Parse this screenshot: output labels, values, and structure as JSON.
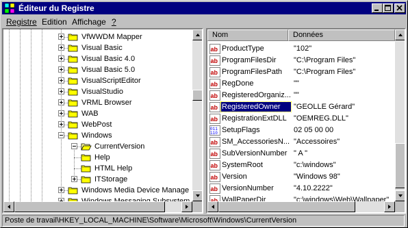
{
  "window": {
    "title": "Éditeur du Registre"
  },
  "menu": [
    {
      "label": "Registre"
    },
    {
      "label": "Edition"
    },
    {
      "label": "Affichage"
    },
    {
      "label": "?"
    }
  ],
  "tree": {
    "items": [
      {
        "label": "VfWWDM Mapper",
        "expander": "plus"
      },
      {
        "label": "Visual Basic",
        "expander": "plus"
      },
      {
        "label": "Visual Basic 4.0",
        "expander": "plus"
      },
      {
        "label": "Visual Basic 5.0",
        "expander": "plus"
      },
      {
        "label": "VisualScriptEditor",
        "expander": "plus"
      },
      {
        "label": "VisualStudio",
        "expander": "plus"
      },
      {
        "label": "VRML Browser",
        "expander": "plus"
      },
      {
        "label": "WAB",
        "expander": "plus"
      },
      {
        "label": "WebPost",
        "expander": "plus"
      },
      {
        "label": "Windows",
        "expander": "minus"
      },
      {
        "label": "CurrentVersion",
        "expander": "minus"
      },
      {
        "label": "Help",
        "expander": "none"
      },
      {
        "label": "HTML Help",
        "expander": "none"
      },
      {
        "label": "ITStorage",
        "expander": "plus"
      },
      {
        "label": "Windows Media Device Manage",
        "expander": "plus"
      },
      {
        "label": "Windows Messaging Subsystem",
        "expander": "plus"
      }
    ]
  },
  "values": {
    "header": {
      "name": "Nom",
      "data": "Données"
    },
    "rows": [
      {
        "icon": "string-icon",
        "name": "ProductType",
        "data": "\"102\""
      },
      {
        "icon": "string-icon",
        "name": "ProgramFilesDir",
        "data": "\"C:\\Program Files\""
      },
      {
        "icon": "string-icon",
        "name": "ProgramFilesPath",
        "data": "\"C:\\Program Files\""
      },
      {
        "icon": "string-icon",
        "name": "RegDone",
        "data": "\"\""
      },
      {
        "icon": "string-icon",
        "name": "RegisteredOrganiz...",
        "data": "\"\""
      },
      {
        "icon": "string-icon",
        "name": "RegisteredOwner",
        "data": "\"GEOLLE Gérard\""
      },
      {
        "icon": "string-icon",
        "name": "RegistrationExtDLL",
        "data": "\"OEMREG.DLL\""
      },
      {
        "icon": "binary-icon",
        "name": "SetupFlags",
        "data": "02 05 00 00"
      },
      {
        "icon": "string-icon",
        "name": "SM_AccessoriesN...",
        "data": "\"Accessoires\""
      },
      {
        "icon": "string-icon",
        "name": "SubVersionNumber",
        "data": "\" A \""
      },
      {
        "icon": "string-icon",
        "name": "SystemRoot",
        "data": "\"c:\\windows\""
      },
      {
        "icon": "string-icon",
        "name": "Version",
        "data": "\"Windows 98\""
      },
      {
        "icon": "string-icon",
        "name": "VersionNumber",
        "data": "\"4.10.2222\""
      },
      {
        "icon": "string-icon",
        "name": "WallPaperDir",
        "data": "\"c:\\windows\\Web\\Wallpaper\""
      }
    ]
  },
  "status": {
    "path": "Poste de travail\\HKEY_LOCAL_MACHINE\\Software\\Microsoft\\Windows\\CurrentVersion"
  },
  "colors": {
    "titlebar": "#000080",
    "selection": "#000080",
    "face": "#c0c0c0"
  }
}
